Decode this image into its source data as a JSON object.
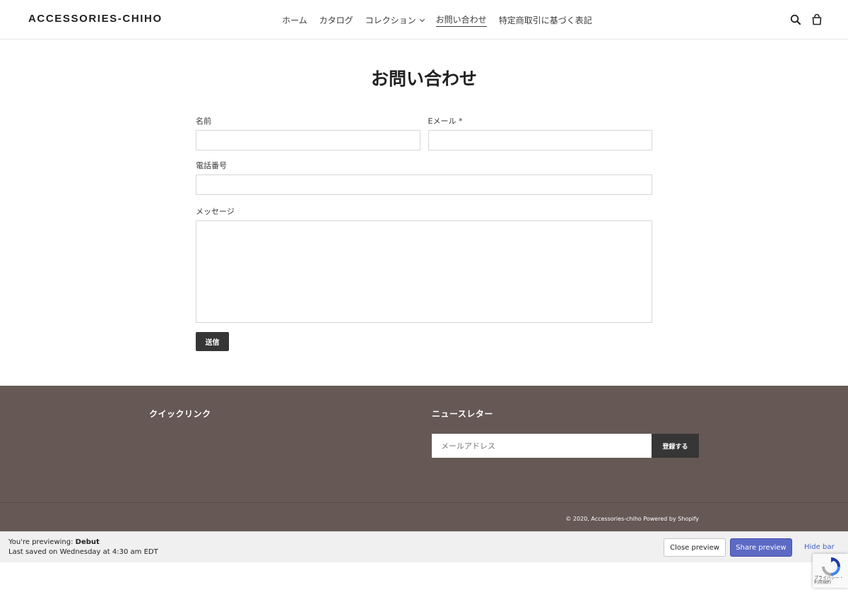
{
  "header": {
    "logo": "ACCESSORIES-CHIHO",
    "nav": [
      {
        "label": "ホーム"
      },
      {
        "label": "カタログ"
      },
      {
        "label": "コレクション"
      },
      {
        "label": "お問い合わせ"
      },
      {
        "label": "特定商取引に基づく表記"
      }
    ],
    "icons": [
      "search-icon",
      "cart-icon"
    ]
  },
  "main": {
    "title": "お問い合わせ",
    "form": {
      "name_label": "名前",
      "email_label": "Eメール *",
      "phone_label": "電話番号",
      "message_label": "メッセージ",
      "submit_label": "送信"
    }
  },
  "footer": {
    "quicklinks_heading": "クイックリンク",
    "newsletter_heading": "ニュースレター",
    "newsletter_placeholder": "メールアドレス",
    "subscribe_label": "登録する",
    "copyright": "© 2020, Accessories-chiho Powered by Shopify"
  },
  "preview_bar": {
    "previewing_prefix": "You're previewing: ",
    "theme_name": "Debut",
    "last_saved": "Last saved on Wednesday at 4:30 am EDT",
    "close_label": "Close preview",
    "share_label": "Share preview",
    "hide_label": "Hide bar"
  },
  "recaptcha": {
    "text1": "プライバシー・",
    "text2": "利用規約"
  },
  "colors": {
    "footer_bg": "#665855",
    "button_dark": "#363636",
    "share_button": "#5c6ac4",
    "link_blue": "#3d63c7"
  }
}
